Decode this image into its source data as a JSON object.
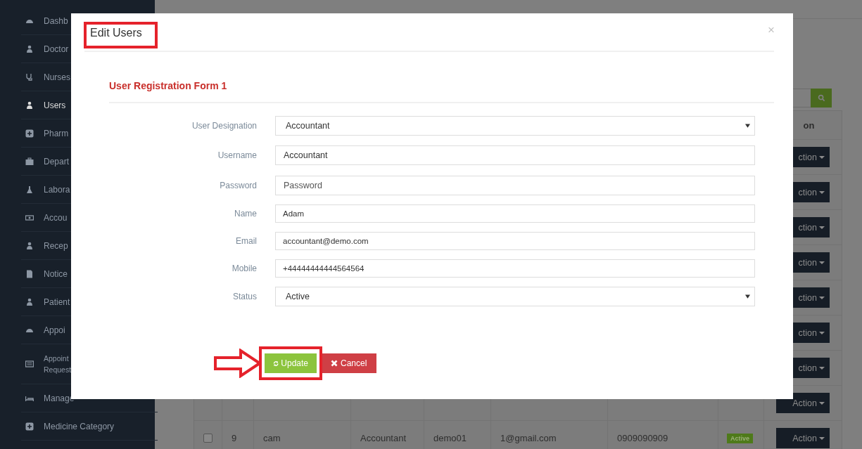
{
  "sidebar": {
    "items": [
      {
        "label": "Dashb",
        "selected": false
      },
      {
        "label": "Doctor",
        "selected": false
      },
      {
        "label": "Nurses",
        "selected": false
      },
      {
        "label": "Users",
        "selected": true
      },
      {
        "label": "Pharm",
        "selected": false
      },
      {
        "label": "Depart",
        "selected": false
      },
      {
        "label": "Labora",
        "selected": false
      },
      {
        "label": "Accou",
        "selected": false
      },
      {
        "label": "Recep",
        "selected": false
      },
      {
        "label": "Notice",
        "selected": false
      },
      {
        "label": "Patient",
        "selected": false
      },
      {
        "label": "Appoi",
        "selected": false
      },
      {
        "label": "Appoint Request",
        "selected": false
      },
      {
        "label": "Manage",
        "selected": false
      },
      {
        "label": "Medicine Category",
        "selected": false
      }
    ]
  },
  "table": {
    "columns": [
      "on"
    ],
    "rows": [
      {
        "action": "ction"
      },
      {
        "action": "ction"
      },
      {
        "action": "ction"
      },
      {
        "action": "ction"
      },
      {
        "action": "ction"
      },
      {
        "action": "ction"
      },
      {
        "action": "ction"
      },
      {
        "action": "Action"
      },
      {
        "checked": false,
        "cells": [
          "9",
          "cam",
          "Accountant",
          "demo01",
          "1@gmail.com",
          "0909090909"
        ],
        "status": "Active",
        "action": "Action"
      }
    ]
  },
  "modal": {
    "title": "Edit Users",
    "close": "×",
    "section_title": "User Registration Form 1",
    "fields": [
      {
        "label": "User Designation",
        "kind": "select",
        "value": "Accountant"
      },
      {
        "label": "Username",
        "kind": "input",
        "value": "Accountant"
      },
      {
        "label": "Password",
        "kind": "input",
        "placeholder": "Password"
      },
      {
        "label": "Name",
        "kind": "input",
        "value": "Adam"
      },
      {
        "label": "Email",
        "kind": "input",
        "value": "accountant@demo.com"
      },
      {
        "label": "Mobile",
        "kind": "input",
        "value": "+44444444444564564"
      },
      {
        "label": "Status",
        "kind": "select",
        "value": "Active"
      }
    ],
    "buttons": [
      {
        "label": "Update",
        "kind": "update"
      },
      {
        "label": "Cancel",
        "kind": "cancel"
      }
    ]
  }
}
